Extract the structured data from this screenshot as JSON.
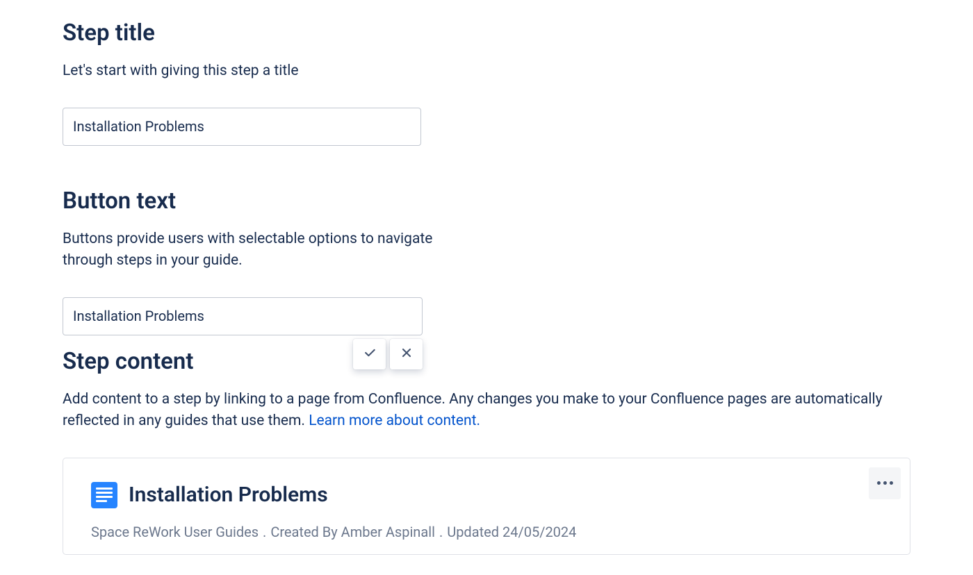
{
  "stepTitle": {
    "heading": "Step title",
    "description": "Let's start with giving this step a title",
    "value": "Installation Problems"
  },
  "buttonText": {
    "heading": "Button text",
    "description": "Buttons provide users with selectable options to navigate through steps in your guide.",
    "value": "Installation Problems"
  },
  "stepContent": {
    "heading": "Step content",
    "description": "Add content to a step by linking to a page from Confluence. Any changes you make to your Confluence pages are automatically reflected in any guides that use them. ",
    "learnMoreLabel": "Learn more about content."
  },
  "contentCard": {
    "title": "Installation Problems",
    "space": "Space ReWork User Guides",
    "createdBy": "Created By Amber Aspinall",
    "updated": "Updated 24/05/2024"
  }
}
